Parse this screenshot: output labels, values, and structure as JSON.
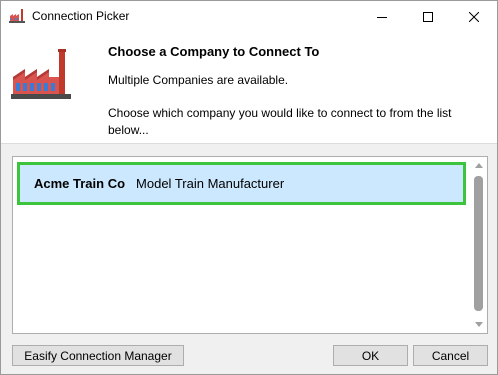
{
  "window": {
    "title": "Connection Picker",
    "title_icon": "factory-icon",
    "controls": [
      "minimize-icon",
      "maximize-icon",
      "close-icon"
    ]
  },
  "header": {
    "title": "Choose a Company to Connect To",
    "subtitle": "Multiple Companies are available.",
    "description": "Choose which company you would like to connect to from the list below..."
  },
  "companies": [
    {
      "name": "Acme Train Co",
      "description": "Model Train Manufacturer",
      "selected": true
    }
  ],
  "buttons": {
    "easify": "Easify Connection Manager",
    "ok": "OK",
    "cancel": "Cancel"
  },
  "colors": {
    "selection_bg": "#cce8ff",
    "highlight_border": "#3cc43c",
    "factory_red": "#c0392b"
  }
}
